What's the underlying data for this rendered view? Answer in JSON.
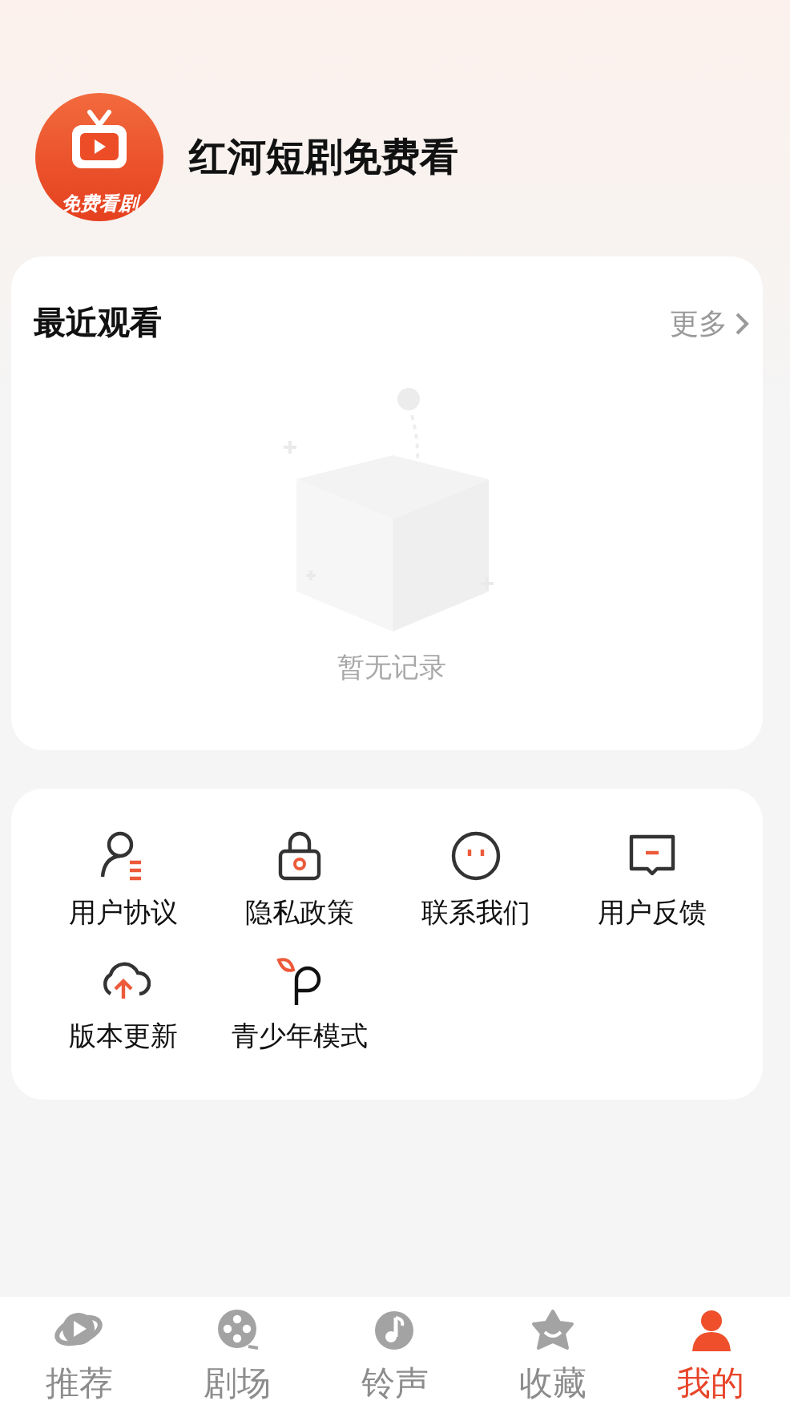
{
  "header": {
    "logo_text": "免费看剧",
    "title": "红河短剧免费看"
  },
  "recent": {
    "title": "最近观看",
    "more": "更多",
    "empty_text": "暂无记录"
  },
  "menu": [
    {
      "label": "用户协议"
    },
    {
      "label": "隐私政策"
    },
    {
      "label": "联系我们"
    },
    {
      "label": "用户反馈"
    },
    {
      "label": "版本更新"
    },
    {
      "label": "青少年模式"
    }
  ],
  "tabs": [
    {
      "label": "推荐",
      "selected": false
    },
    {
      "label": "剧场",
      "selected": false
    },
    {
      "label": "铃声",
      "selected": false
    },
    {
      "label": "收藏",
      "selected": false
    },
    {
      "label": "我的",
      "selected": true
    }
  ]
}
